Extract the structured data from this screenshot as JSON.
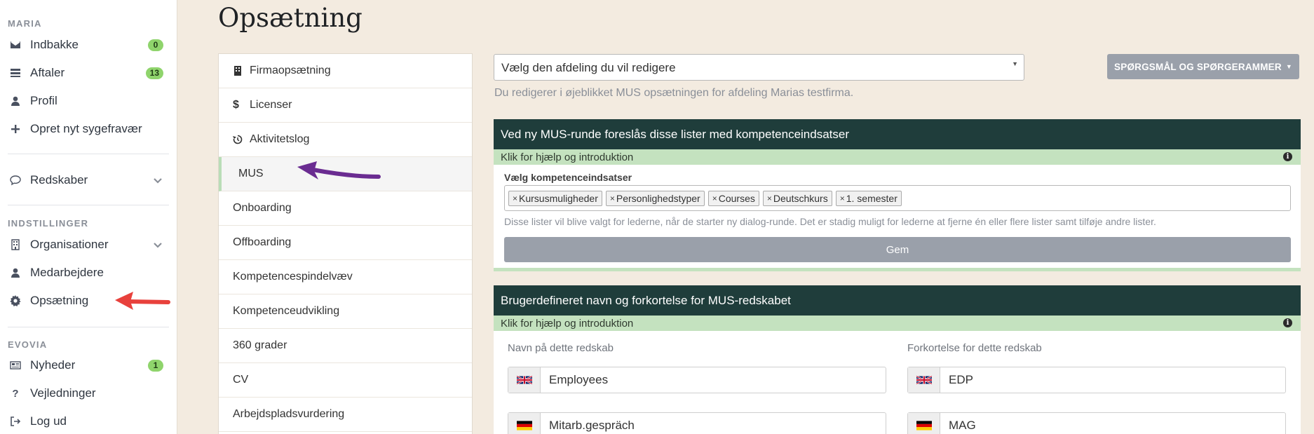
{
  "sidebar": {
    "sections": {
      "maria": "MARIA",
      "settings": "INDSTILLINGER",
      "evovia": "EVOVIA"
    },
    "items": {
      "inbox": {
        "label": "Indbakke",
        "badge": "0",
        "icon": "envelope-icon"
      },
      "appointments": {
        "label": "Aftaler",
        "badge": "13",
        "icon": "list-icon"
      },
      "profile": {
        "label": "Profil",
        "icon": "user-icon"
      },
      "new_absence": {
        "label": "Opret nyt sygefravær",
        "icon": "plus-icon"
      },
      "tools": {
        "label": "Redskaber",
        "icon": "chat-icon"
      },
      "organisations": {
        "label": "Organisationer",
        "icon": "building-icon"
      },
      "employees": {
        "label": "Medarbejdere",
        "icon": "user-icon"
      },
      "setup": {
        "label": "Opsætning",
        "icon": "gear-icon"
      },
      "news": {
        "label": "Nyheder",
        "badge": "1",
        "icon": "newspaper-icon"
      },
      "guides": {
        "label": "Vejledninger",
        "icon": "question-icon"
      },
      "logout": {
        "label": "Log ud",
        "icon": "logout-icon"
      }
    }
  },
  "page": {
    "title": "Opsætning"
  },
  "menu": {
    "items": [
      {
        "label": "Firmaopsætning",
        "icon": "building-icon"
      },
      {
        "label": "Licenser",
        "icon": "dollar-icon"
      },
      {
        "label": "Aktivitetslog",
        "icon": "history-icon"
      },
      {
        "label": "MUS",
        "active": true
      },
      {
        "label": "Onboarding"
      },
      {
        "label": "Offboarding"
      },
      {
        "label": "Kompetencespindelvæv"
      },
      {
        "label": "Kompetenceudvikling"
      },
      {
        "label": "360 grader"
      },
      {
        "label": "CV"
      },
      {
        "label": "Arbejdspladsvurdering"
      }
    ]
  },
  "content": {
    "department_select": "Vælg den afdeling du vil redigere",
    "questions_button": "SPØRGSMÅL OG SPØRGERAMMER",
    "info_text": "Du redigerer i øjeblikket MUS opsætningen for afdeling Marias testfirma.",
    "panel1": {
      "heading": "Ved ny MUS-runde foreslås disse lister med kompetenceindsatser",
      "help": "Klik for hjælp og introduktion",
      "field_label": "Vælg kompetenceindsatser",
      "tags": [
        "Kursusmuligheder",
        "Personlighedstyper",
        "Courses",
        "Deutschkurs",
        "1. semester"
      ],
      "hint": "Disse lister vil blive valgt for lederne, når de starter ny dialog-runde. Det er stadig muligt for lederne at fjerne én eller flere lister samt tilføje andre lister.",
      "save": "Gem"
    },
    "panel2": {
      "heading": "Brugerdefineret navn og forkortelse for MUS-redskabet",
      "help": "Klik for hjælp og introduktion",
      "name_label": "Navn på dette redskab",
      "abbr_label": "Forkortelse for dette redskab",
      "name_en": "Employees",
      "name_de": "Mitarb.gespräch",
      "abbr_en": "EDP",
      "abbr_de": "MAG"
    }
  },
  "colors": {
    "accent_dark": "#1f3d3b",
    "accent_green": "#c4e2bf",
    "badge": "#8fd46c",
    "arrow_red": "#e8413c",
    "arrow_purple": "#6a2c91"
  }
}
